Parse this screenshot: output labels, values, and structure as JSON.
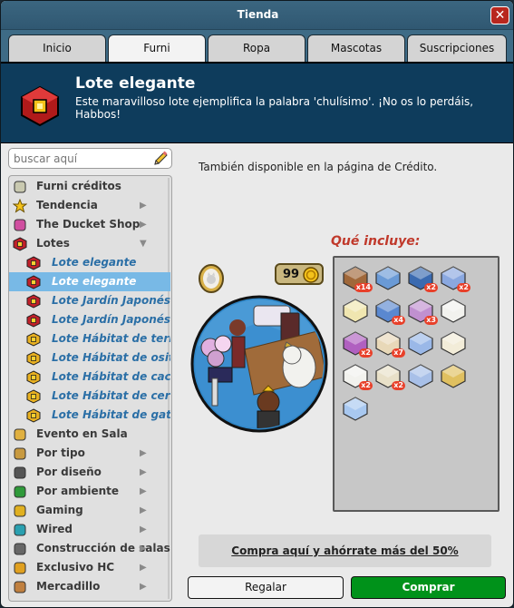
{
  "window": {
    "title": "Tienda",
    "close_glyph": "✕"
  },
  "tabs": [
    {
      "label": "Inicio",
      "active": false
    },
    {
      "label": "Furni",
      "active": true
    },
    {
      "label": "Ropa",
      "active": false
    },
    {
      "label": "Mascotas",
      "active": false
    },
    {
      "label": "Suscripciones",
      "active": false
    }
  ],
  "banner": {
    "title": "Lote elegante",
    "description": "Este maravilloso lote ejemplifica la palabra 'chulísimo'. ¡No os lo perdáis, Habbos!",
    "icon": "bundle-cube-icon"
  },
  "search": {
    "placeholder": "buscar aquí",
    "value": ""
  },
  "sidebar": {
    "items": [
      {
        "label": "Furni créditos",
        "icon": "coins-icon",
        "level": 0,
        "arrow": "",
        "selected": false
      },
      {
        "label": "Tendencia",
        "icon": "star-icon",
        "level": 0,
        "arrow": "▶",
        "selected": false
      },
      {
        "label": "The Ducket Shop",
        "icon": "ducket-icon",
        "level": 0,
        "arrow": "▶",
        "selected": false
      },
      {
        "label": "Lotes",
        "icon": "bundle-cube-icon",
        "level": 0,
        "arrow": "▼",
        "selected": false
      },
      {
        "label": "Lote elegante",
        "icon": "bundle-cube-icon",
        "level": 1,
        "arrow": "",
        "selected": false
      },
      {
        "label": "Lote elegante",
        "icon": "bundle-cube-icon",
        "level": 1,
        "arrow": "",
        "selected": true
      },
      {
        "label": "Lote Jardín Japonés",
        "icon": "bundle-cube-icon",
        "level": 1,
        "arrow": "",
        "selected": false
      },
      {
        "label": "Lote Jardín Japonés",
        "icon": "bundle-cube-icon",
        "level": 1,
        "arrow": "",
        "selected": false
      },
      {
        "label": "Lote Hábitat de terriers",
        "icon": "bundle-gold-icon",
        "level": 1,
        "arrow": "",
        "selected": false
      },
      {
        "label": "Lote Hábitat de osito polar",
        "icon": "bundle-gold-icon",
        "level": 1,
        "arrow": "",
        "selected": false
      },
      {
        "label": "Lote Hábitat de cachorros",
        "icon": "bundle-gold-icon",
        "level": 1,
        "arrow": "",
        "selected": false
      },
      {
        "label": "Lote Hábitat de cerditos",
        "icon": "bundle-gold-icon",
        "level": 1,
        "arrow": "",
        "selected": false
      },
      {
        "label": "Lote Hábitat de gatitos",
        "icon": "bundle-gold-icon",
        "level": 1,
        "arrow": "",
        "selected": false
      },
      {
        "label": "Evento en Sala",
        "icon": "event-box-icon",
        "level": 0,
        "arrow": "",
        "selected": false
      },
      {
        "label": "Por tipo",
        "icon": "type-box-icon",
        "level": 0,
        "arrow": "▶",
        "selected": false
      },
      {
        "label": "Por diseño",
        "icon": "columns-icon",
        "level": 0,
        "arrow": "▶",
        "selected": false
      },
      {
        "label": "Por ambiente",
        "icon": "plant-icon",
        "level": 0,
        "arrow": "▶",
        "selected": false
      },
      {
        "label": "Gaming",
        "icon": "medal-icon",
        "level": 0,
        "arrow": "▶",
        "selected": false
      },
      {
        "label": "Wired",
        "icon": "wired-icon",
        "level": 0,
        "arrow": "▶",
        "selected": false
      },
      {
        "label": "Construcción de salas",
        "icon": "pickaxe-icon",
        "level": 0,
        "arrow": "▶",
        "selected": false
      },
      {
        "label": "Exclusivo HC",
        "icon": "hc-icon",
        "level": 0,
        "arrow": "▶",
        "selected": false
      },
      {
        "label": "Mercadillo",
        "icon": "market-icon",
        "level": 0,
        "arrow": "▶",
        "selected": false
      }
    ]
  },
  "main": {
    "availability_text": "También disponible en la página de Crédito.",
    "price": "99",
    "includes_label": "Qué incluye:",
    "items": [
      {
        "icon": "wood-floor-icon",
        "qty": "x14"
      },
      {
        "icon": "bed-icon",
        "qty": ""
      },
      {
        "icon": "curtain-icon",
        "qty": "x2"
      },
      {
        "icon": "armchair-icon",
        "qty": "x2"
      },
      {
        "icon": "wardrobe-icon",
        "qty": ""
      },
      {
        "icon": "rug-icon",
        "qty": "x4"
      },
      {
        "icon": "flower-vase-icon",
        "qty": "x3"
      },
      {
        "icon": "cat-statue-icon",
        "qty": ""
      },
      {
        "icon": "mirror-icon",
        "qty": "x2"
      },
      {
        "icon": "wall-panel-icon",
        "qty": "x7"
      },
      {
        "icon": "sofa-icon",
        "qty": ""
      },
      {
        "icon": "table-icon",
        "qty": ""
      },
      {
        "icon": "side-table-icon",
        "qty": "x2"
      },
      {
        "icon": "teapot-icon",
        "qty": "x2"
      },
      {
        "icon": "vanity-icon",
        "qty": ""
      },
      {
        "icon": "chandelier-icon",
        "qty": ""
      },
      {
        "icon": "bathtub-icon",
        "qty": ""
      }
    ],
    "offer_link": "Compra aquí y ahórrate más del 50%",
    "gift_button": "Regalar",
    "buy_button": "Comprar"
  },
  "colors": {
    "accent_blue": "#0e3c5c",
    "selected": "#78b9e6",
    "buy_green": "#00921a",
    "includes_red": "#c0392b"
  }
}
